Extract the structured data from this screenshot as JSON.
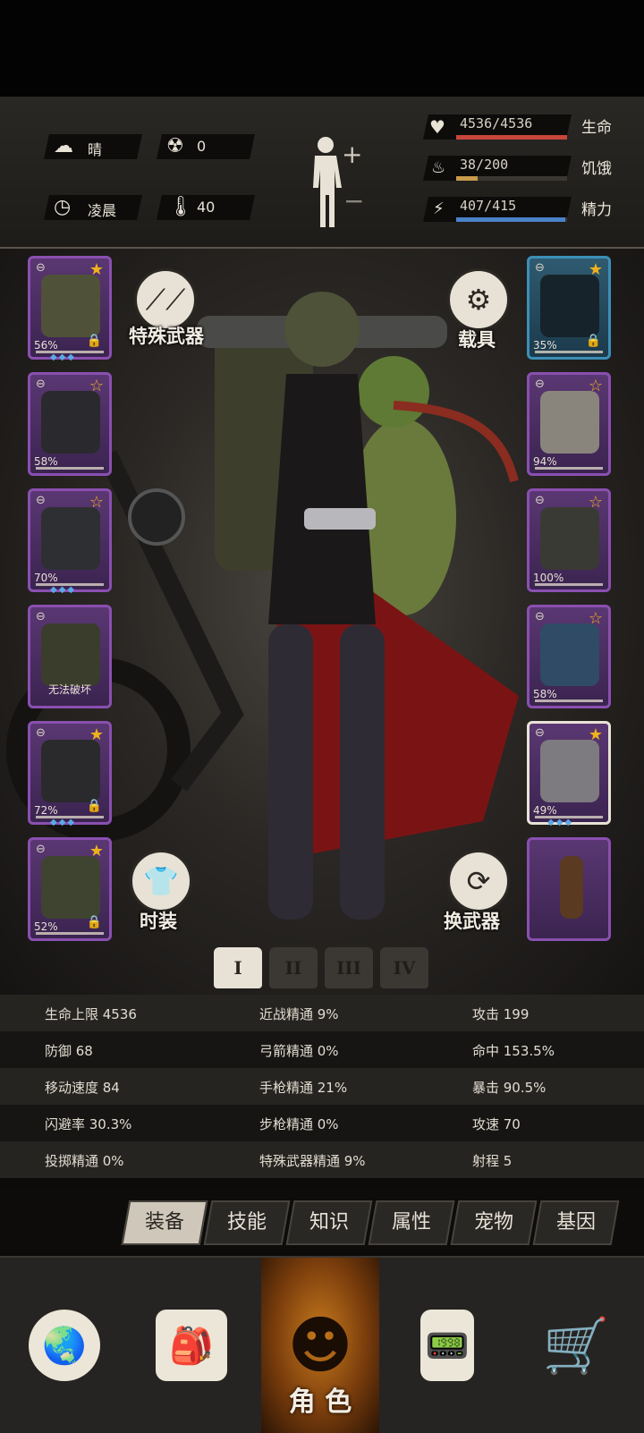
{
  "status": {
    "weather": {
      "icon": "cloud-sun-icon",
      "label": "晴"
    },
    "radiation": {
      "icon": "radiation-icon",
      "value": "0"
    },
    "time": {
      "icon": "clock-icon",
      "label": "凌晨"
    },
    "temperature": {
      "icon": "thermometer-icon",
      "value": "40"
    },
    "health": {
      "icon": "heart-icon",
      "text": "4536/4536",
      "label": "生命",
      "fraction": 1.0,
      "color": "#c8463a"
    },
    "hunger": {
      "icon": "stomach-icon",
      "text": "38/200",
      "label": "饥饿",
      "fraction": 0.19,
      "color": "#c99b4a"
    },
    "energy": {
      "icon": "bolt-head-icon",
      "text": "407/415",
      "label": "精力",
      "fraction": 0.98,
      "color": "#4a82c9"
    }
  },
  "left_slots": [
    {
      "name": "helmet",
      "pct": "56%",
      "star": "gold",
      "locked": true,
      "gems": "◆◆◆"
    },
    {
      "name": "jacket",
      "pct": "58%",
      "star": "gold-outline",
      "locked": false,
      "gems": ""
    },
    {
      "name": "coat",
      "pct": "70%",
      "star": "gold-outline",
      "locked": false,
      "gems": "◆◆◆"
    },
    {
      "name": "backpack",
      "pct": "",
      "star": "",
      "locked": false,
      "gems": "",
      "note": "无法破坏"
    },
    {
      "name": "pants",
      "pct": "72%",
      "star": "gold",
      "locked": true,
      "gems": "◆◆◆"
    },
    {
      "name": "boots",
      "pct": "52%",
      "star": "gold",
      "locked": true,
      "gems": ""
    }
  ],
  "right_slots": [
    {
      "name": "glasses",
      "pct": "35%",
      "star": "gold",
      "locked": true,
      "gems": ""
    },
    {
      "name": "gas-mask",
      "pct": "94%",
      "star": "gold-outline",
      "locked": false,
      "gems": ""
    },
    {
      "name": "vest",
      "pct": "100%",
      "star": "gold-outline",
      "locked": false,
      "gems": ""
    },
    {
      "name": "shield-pad",
      "pct": "58%",
      "star": "gold-outline",
      "locked": false,
      "gems": ""
    },
    {
      "name": "pistol",
      "pct": "49%",
      "star": "gold",
      "locked": false,
      "gems": "◆◆◆"
    },
    {
      "name": "molotov",
      "pct": "",
      "star": "",
      "locked": false,
      "gems": ""
    }
  ],
  "buttons": {
    "special_weapon": "特殊武器",
    "vehicle": "载具",
    "fashion": "时装",
    "swap_weapon": "换武器"
  },
  "loadouts": [
    "I",
    "II",
    "III",
    "IV"
  ],
  "stats": [
    [
      "生命上限 4536",
      "近战精通 9%",
      "攻击 199"
    ],
    [
      "防御 68",
      "弓箭精通 0%",
      "命中 153.5%"
    ],
    [
      "移动速度 84",
      "手枪精通 21%",
      "暴击 90.5%"
    ],
    [
      "闪避率 30.3%",
      "步枪精通 0%",
      "攻速 70"
    ],
    [
      "投掷精通 0%",
      "特殊武器精通 9%",
      "射程 5"
    ]
  ],
  "tabs": [
    "装备",
    "技能",
    "知识",
    "属性",
    "宠物",
    "基因"
  ],
  "nav": {
    "map": "globe-icon",
    "bag": "backpack-icon",
    "character": "角 色",
    "radio": "walkie-talkie-icon",
    "shop": "cart-icon"
  }
}
